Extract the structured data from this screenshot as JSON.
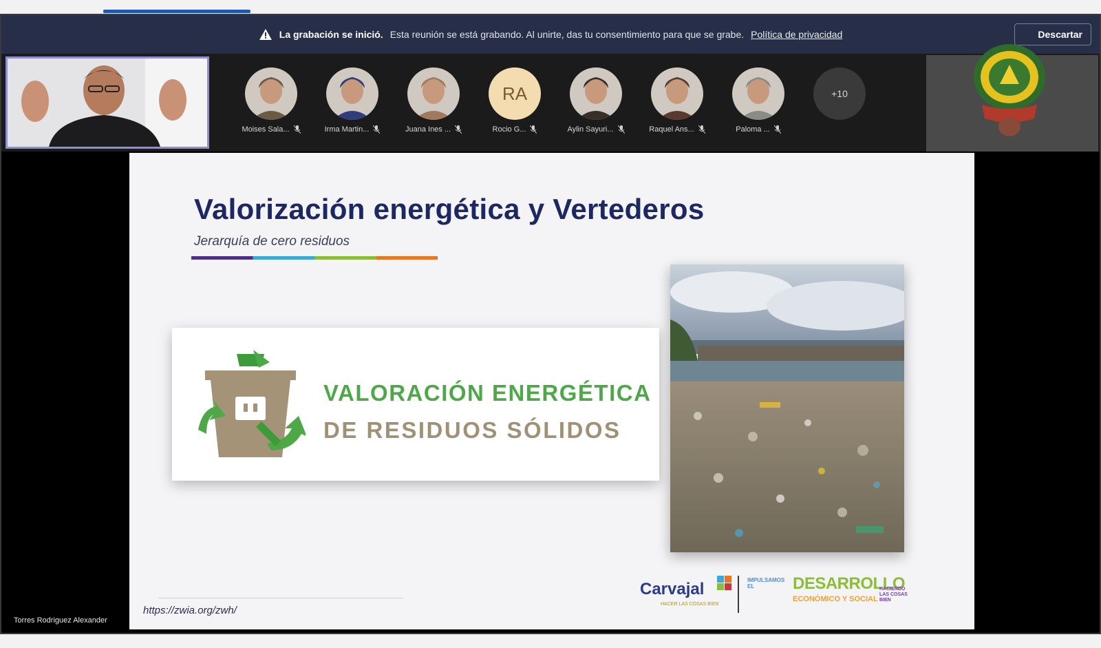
{
  "banner": {
    "title": "La grabación se inició.",
    "message": "Esta reunión se está grabando. Al unirte, das tu consentimiento para que se grabe.",
    "link": "Política de privacidad",
    "dismiss_label": "Descartar"
  },
  "participants": [
    {
      "name": "Moises Sala...",
      "avatar": "photo",
      "color": "#6b5a46"
    },
    {
      "name": "Irma Martin...",
      "avatar": "photo",
      "color": "#2f3e7a"
    },
    {
      "name": "Juana Ines ...",
      "avatar": "photo",
      "color": "#a07a5c"
    },
    {
      "name": "Rocio G...",
      "avatar": "initials",
      "initials": "RA"
    },
    {
      "name": "Aylin Sayuri...",
      "avatar": "photo",
      "color": "#3a2e2a"
    },
    {
      "name": "Raquel Ans...",
      "avatar": "photo",
      "color": "#5a3a2e"
    },
    {
      "name": "Paloma ...",
      "avatar": "photo",
      "color": "#8a8a86"
    }
  ],
  "more_participants": "+10",
  "speaker": {
    "name": "Torres Rodriguez Alexander"
  },
  "slide": {
    "title": "Valorización energética y Vertederos",
    "subtitle": "Jerarquía de cero residuos",
    "card_line1": "VALORACIÓN ENERGÉTICA",
    "card_line2": "DE RESIDUOS SÓLIDOS",
    "url": "https://zwia.org/zwh/",
    "logo_carvajal": "Carvajal",
    "logo_carvajal_tag": "HACER LAS COSAS BIEN",
    "logo_dev_small": "IMPULSAMOS EL",
    "logo_dev_big": "DESARROLLO",
    "logo_dev_eco": "ECONÓMICO Y SOCIAL",
    "logo_dev_right": "HACIENDO LAS COSAS BIEN"
  },
  "colors": {
    "title": "#1d2762",
    "green": "#4ea848",
    "tan": "#a09075",
    "banner_bg": "#262f47"
  }
}
